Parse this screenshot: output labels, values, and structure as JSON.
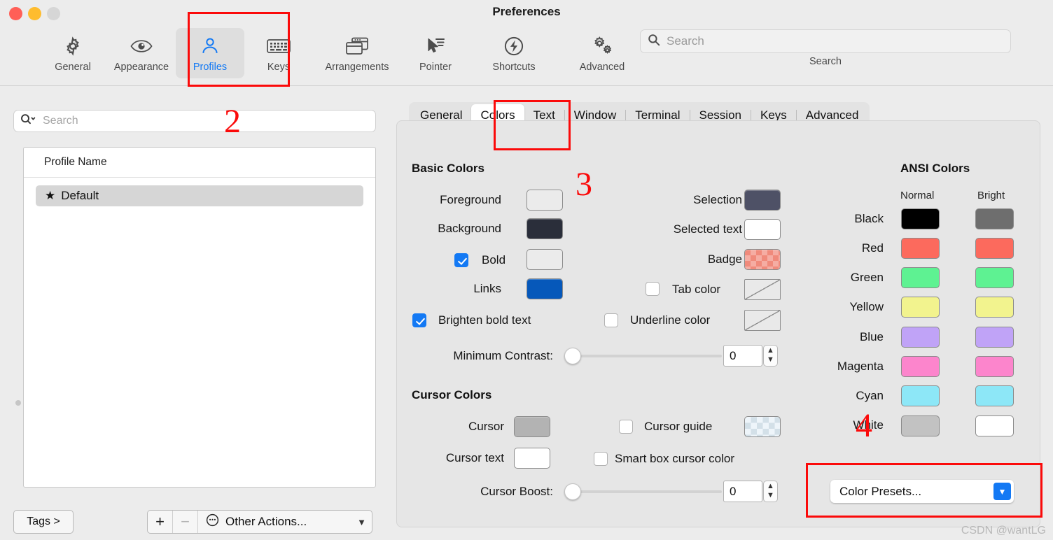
{
  "window": {
    "title": "Preferences",
    "traffic_lights": [
      "close",
      "minimize",
      "zoom"
    ]
  },
  "toolbar": {
    "items": [
      {
        "label": "General",
        "icon": "gear-icon",
        "selected": false
      },
      {
        "label": "Appearance",
        "icon": "eye-icon",
        "selected": false
      },
      {
        "label": "Profiles",
        "icon": "person-icon",
        "selected": true
      },
      {
        "label": "Keys",
        "icon": "keyboard-icon",
        "selected": false
      },
      {
        "label": "Arrangements",
        "icon": "windows-icon",
        "selected": false
      },
      {
        "label": "Pointer",
        "icon": "cursor-icon",
        "selected": false
      },
      {
        "label": "Shortcuts",
        "icon": "bolt-icon",
        "selected": false
      },
      {
        "label": "Advanced",
        "icon": "gears-icon",
        "selected": false
      }
    ],
    "search": {
      "placeholder": "Search",
      "value": "",
      "caption": "Search",
      "icon": "search-icon"
    }
  },
  "left_pane": {
    "search": {
      "placeholder": "Search",
      "value": "",
      "icon": "search-dropdown-icon"
    },
    "table": {
      "header": "Profile Name",
      "rows": [
        {
          "name": "Default",
          "starred": true,
          "selected": true
        }
      ]
    },
    "footer": {
      "tags_label": "Tags >",
      "add_label": "+",
      "remove_label": "−",
      "other_actions_label": "Other Actions...",
      "other_actions_icon": "ellipsis-circle-icon",
      "chevron": "⌄"
    }
  },
  "tabs": [
    {
      "label": "General",
      "active": false
    },
    {
      "label": "Colors",
      "active": true
    },
    {
      "label": "Text",
      "active": false
    },
    {
      "label": "Window",
      "active": false
    },
    {
      "label": "Terminal",
      "active": false
    },
    {
      "label": "Session",
      "active": false
    },
    {
      "label": "Keys",
      "active": false
    },
    {
      "label": "Advanced",
      "active": false
    }
  ],
  "basic_colors": {
    "title": "Basic Colors",
    "left_rows": [
      {
        "label": "Foreground",
        "color": "#ebebeb",
        "kind": "color"
      },
      {
        "label": "Background",
        "color": "#2a2e3a",
        "kind": "color"
      },
      {
        "label": "Bold",
        "color": "#ebebeb",
        "kind": "color",
        "checkbox": true,
        "checked": true
      },
      {
        "label": "Links",
        "color": "#0658ba",
        "kind": "color"
      }
    ],
    "right_rows": [
      {
        "label": "Selection",
        "color": "#4e5166",
        "kind": "color"
      },
      {
        "label": "Selected text",
        "color": "#ffffff",
        "kind": "color"
      },
      {
        "label": "Badge",
        "color": "#f08a7b",
        "kind": "checker-badge"
      },
      {
        "label": "Tab color",
        "kind": "none",
        "checkbox": true,
        "checked": false
      },
      {
        "label": "Underline color",
        "kind": "none",
        "checkbox": true,
        "checked": false
      }
    ],
    "brighten_bold": {
      "label": "Brighten bold text",
      "checked": true
    },
    "minimum_contrast": {
      "label": "Minimum Contrast:",
      "value": "0",
      "percent": 0
    }
  },
  "cursor_colors": {
    "title": "Cursor Colors",
    "cursor": {
      "label": "Cursor",
      "color": "#b3b3b3"
    },
    "cursor_text": {
      "label": "Cursor text",
      "color": "#ffffff"
    },
    "cursor_guide": {
      "label": "Cursor guide",
      "checked": false,
      "kind": "checker-guide"
    },
    "smart_box": {
      "label": "Smart box cursor color",
      "checked": false
    },
    "cursor_boost": {
      "label": "Cursor Boost:",
      "value": "0",
      "percent": 0
    }
  },
  "ansi_colors": {
    "title": "ANSI Colors",
    "col_normal": "Normal",
    "col_bright": "Bright",
    "rows": [
      {
        "label": "Black",
        "normal": "#000000",
        "bright": "#6e6e6e"
      },
      {
        "label": "Red",
        "normal": "#fc6a5d",
        "bright": "#fc6a5d"
      },
      {
        "label": "Green",
        "normal": "#5ef292",
        "bright": "#5ef292"
      },
      {
        "label": "Yellow",
        "normal": "#f2f38e",
        "bright": "#f2f38e"
      },
      {
        "label": "Blue",
        "normal": "#c0a3f7",
        "bright": "#c0a3f7"
      },
      {
        "label": "Magenta",
        "normal": "#fc85cc",
        "bright": "#fc85cc"
      },
      {
        "label": "Cyan",
        "normal": "#8de7f7",
        "bright": "#8de7f7"
      },
      {
        "label": "White",
        "normal": "#c2c2c2",
        "bright": "#ffffff"
      }
    ]
  },
  "color_presets": {
    "label": "Color Presets...",
    "arrow_icon": "chevron-down-icon"
  },
  "annotations": {
    "n2": "2",
    "n3": "3",
    "n4": "4",
    "accent": "#fb0a0a"
  },
  "watermark": "CSDN @wantLG"
}
